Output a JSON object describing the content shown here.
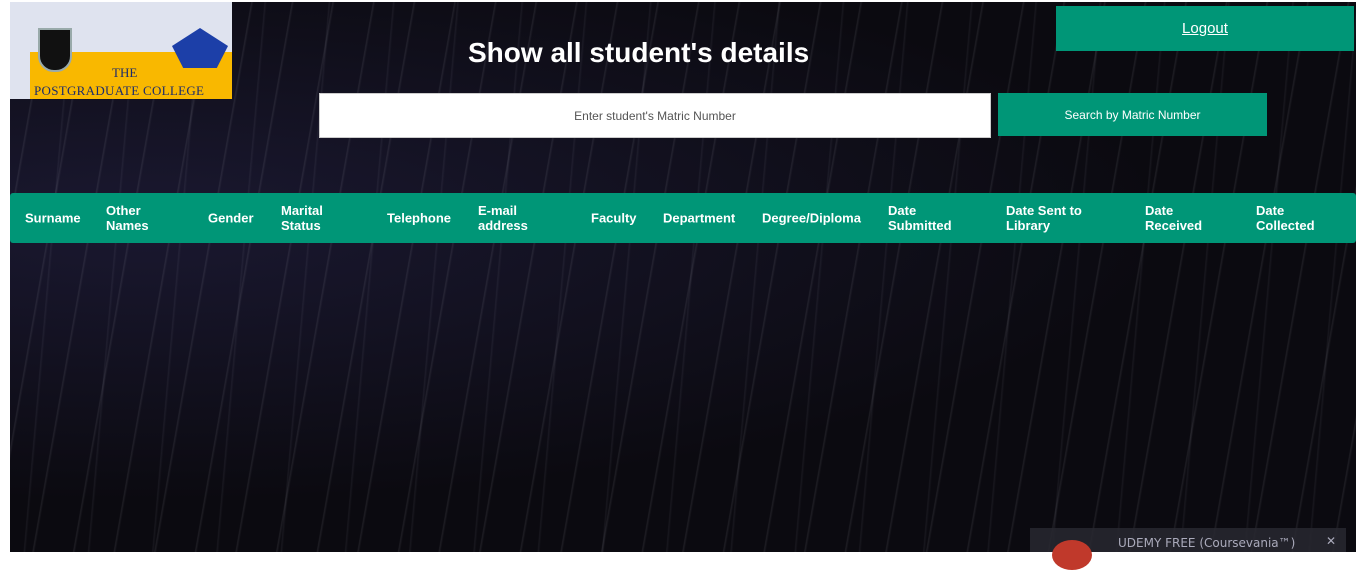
{
  "logo": {
    "line1": "THE",
    "line2": "POSTGRADUATE COLLEGE"
  },
  "header": {
    "title": "Show all student's details",
    "logout_label": "Logout"
  },
  "search": {
    "placeholder": "Enter student's Matric Number",
    "value": "",
    "button_label": "Search by Matric Number"
  },
  "table": {
    "columns": [
      "Surname",
      "Other Names",
      "Gender",
      "Marital Status",
      "Telephone",
      "E-mail address",
      "Faculty",
      "Department",
      "Degree/Diploma",
      "Date Submitted",
      "Date Sent to Library",
      "Date Received",
      "Date Collected"
    ],
    "rows": []
  },
  "notification": {
    "text": "UDEMY FREE (Coursevania™)",
    "close": "✕"
  },
  "colors": {
    "accent": "#009677"
  }
}
